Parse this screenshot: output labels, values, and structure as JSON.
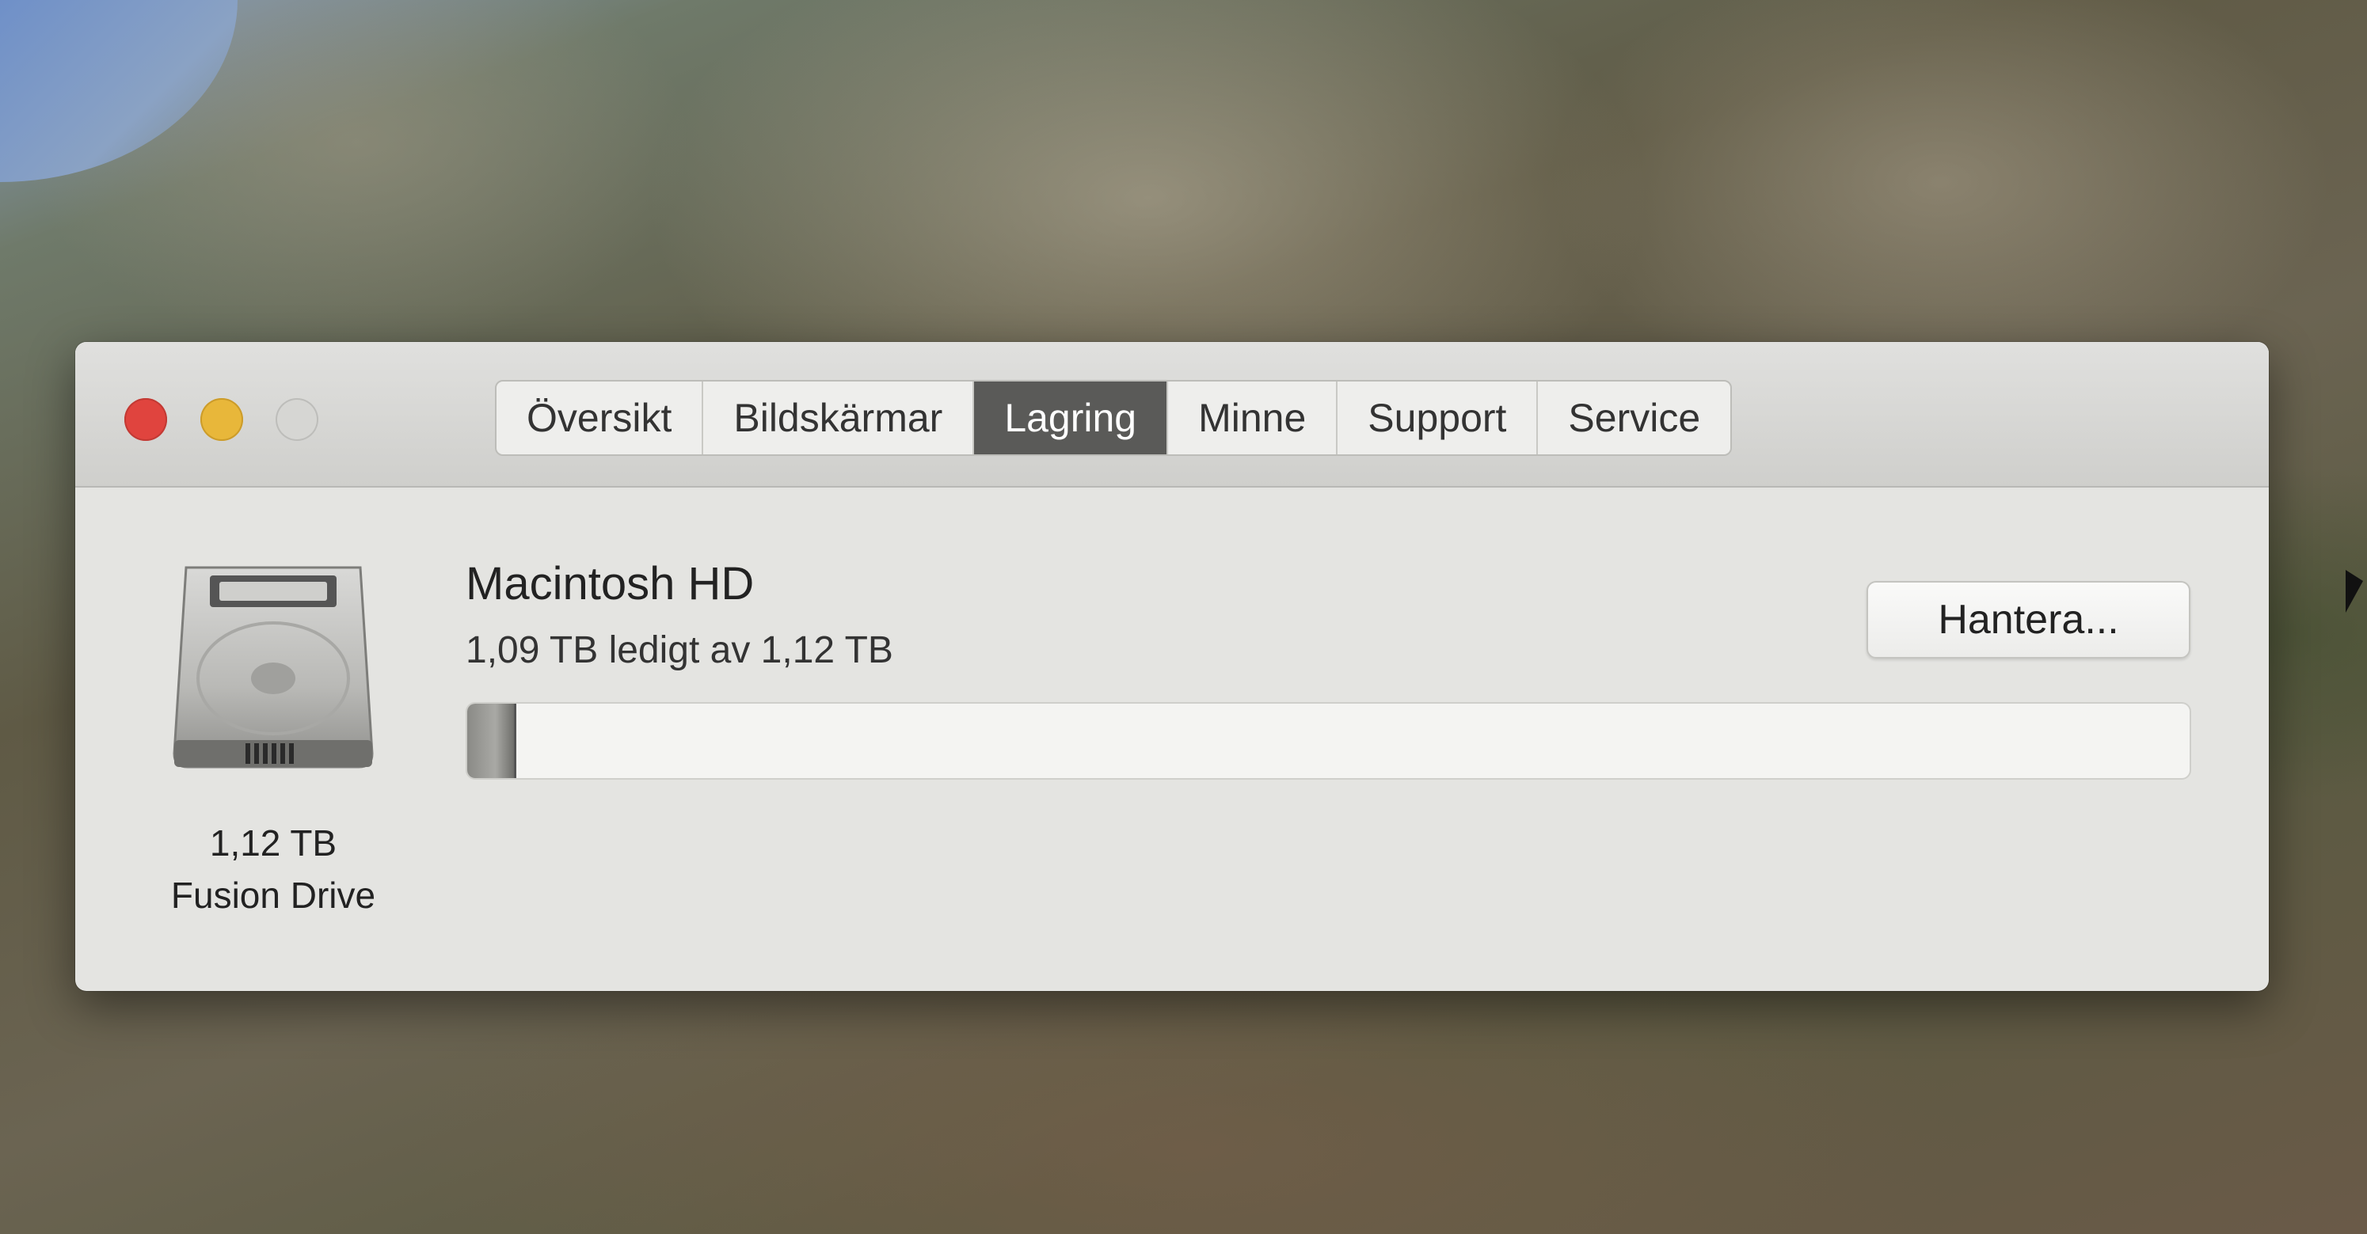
{
  "window": {
    "tabs": [
      {
        "label": "Översikt",
        "active": false
      },
      {
        "label": "Bildskärmar",
        "active": false
      },
      {
        "label": "Lagring",
        "active": true
      },
      {
        "label": "Minne",
        "active": false
      },
      {
        "label": "Support",
        "active": false
      },
      {
        "label": "Service",
        "active": false
      }
    ]
  },
  "storage": {
    "drive_size": "1,12 TB",
    "drive_type": "Fusion Drive",
    "volume_name": "Macintosh HD",
    "free_text": "1,09 TB ledigt av 1,12 TB",
    "used_fraction": 0.027,
    "manage_label": "Hantera..."
  },
  "colors": {
    "close": "#e0443e",
    "minimize": "#e8b73a",
    "zoom": "#d6d6d3",
    "active_tab": "#5a5a58"
  },
  "icons": {
    "drive": "hard-drive-icon"
  }
}
